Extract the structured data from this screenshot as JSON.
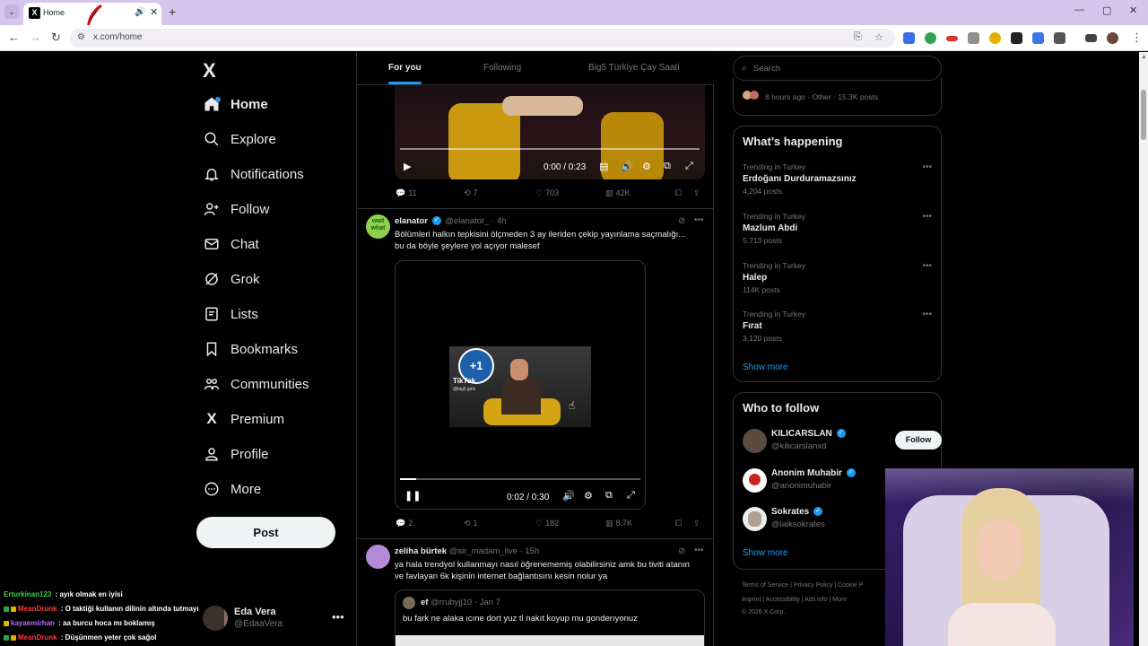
{
  "browser": {
    "tab_title": "Home",
    "url": "x.com/home",
    "favicon": "X",
    "new_tab": "+",
    "win_minimize": "—",
    "win_maximize": "▢",
    "win_close": "✕"
  },
  "nav": {
    "logo": "X",
    "items": [
      {
        "label": "Home",
        "icon": "home-icon"
      },
      {
        "label": "Explore",
        "icon": "search-icon"
      },
      {
        "label": "Notifications",
        "icon": "bell-icon"
      },
      {
        "label": "Follow",
        "icon": "add-user-icon"
      },
      {
        "label": "Chat",
        "icon": "mail-icon"
      },
      {
        "label": "Grok",
        "icon": "grok-icon"
      },
      {
        "label": "Lists",
        "icon": "list-icon"
      },
      {
        "label": "Bookmarks",
        "icon": "bookmark-icon"
      },
      {
        "label": "Communities",
        "icon": "communities-icon"
      },
      {
        "label": "Premium",
        "icon": "x-premium-icon"
      },
      {
        "label": "Profile",
        "icon": "person-icon"
      },
      {
        "label": "More",
        "icon": "more-circle-icon"
      }
    ],
    "post_button": "Post"
  },
  "account": {
    "name": "Eda Vera",
    "handle": "@EdaaVera"
  },
  "chat_overlay": [
    {
      "user": "Erturkinan123",
      "msg": " : ayık olmak en iyisi",
      "color": "#3fd13f"
    },
    {
      "user": "MeanDrunk",
      "msg": " : O taktiği kullanın dilinin altında tutmayı",
      "color": "#ff3b3b"
    },
    {
      "user": "kayaemirhan",
      "msg": " : aa burcu hoca mı boklamış",
      "color": "#b36bff"
    },
    {
      "user": "MeanDrunk",
      "msg": " : Düşünmen yeter çok sağol",
      "color": "#ff3b3b"
    }
  ],
  "feed": {
    "tabs": [
      "For you",
      "Following",
      "Big5 Türkiye Çay Saati"
    ],
    "video1": {
      "time": "0:00 / 0:23"
    },
    "tweet1_stats": {
      "replies": "11",
      "reposts": "7",
      "likes": "703",
      "views": "42K"
    },
    "tweet2": {
      "name": "elanator",
      "handle": "@elanator_ · 4h",
      "text": "Bölümleri halkın tepkisini ölçmeden 3 ay ileriden çekip yayınlama saçmalığı... bu da böyle şeylere yol açıyor malesef",
      "avatar_text": "wait what",
      "video_time": "0:02 / 0:30",
      "video_badge": "+1",
      "video_watermark": "TikTok",
      "video_handle": "@big5.girls",
      "stats": {
        "replies": "2",
        "reposts": "1",
        "likes": "182",
        "views": "8.7K"
      }
    },
    "tweet3": {
      "name": "zeliha bürtek",
      "handle": "@sir_madam_live · 15h",
      "text": "ya hala trendyol kullanmayı nasıl öğrenememiş olabilirsiniz amk bu tiviti atanın ve favlayan 6k kişinin internet bağlantısını kesin nolur ya",
      "quote_name": "ef",
      "quote_handle": "@rrubyjj10 · Jan 7",
      "quote_text": "bu fark ne alaka ıcıne dort yuz tl nakıt koyup mu gonderıyonuz"
    }
  },
  "right": {
    "search_placeholder": "Search",
    "top_card_meta": "8 hours ago · Other · 15.3K posts",
    "whats_happening_title": "What’s happening",
    "trends": [
      {
        "context": "Trending in Turkey",
        "name": "Erdoğanı Durduramazsınız",
        "count": "4,204 posts"
      },
      {
        "context": "Trending in Turkey",
        "name": "Mazlum Abdi",
        "count": "5,713 posts"
      },
      {
        "context": "Trending in Turkey",
        "name": "Halep",
        "count": "114K posts"
      },
      {
        "context": "Trending in Turkey",
        "name": "Fırat",
        "count": "3,120 posts"
      }
    ],
    "show_more": "Show more",
    "who_to_follow_title": "Who to follow",
    "who_to_follow": [
      {
        "name": "KILICARSLAN",
        "handle": "@kilicarslanxd"
      },
      {
        "name": "Anonim Muhabir",
        "handle": "@anonimuhabir"
      },
      {
        "name": "Sokrates",
        "handle": "@laiksokrates"
      }
    ],
    "follow_label": "Follow",
    "footer_line1": "Terms of Service  |  Privacy Policy  |  Cookie P",
    "footer_line2": "Imprint  |  Accessibility  |  Ads info  |  More",
    "footer_line3": "© 2026 X Corp."
  }
}
